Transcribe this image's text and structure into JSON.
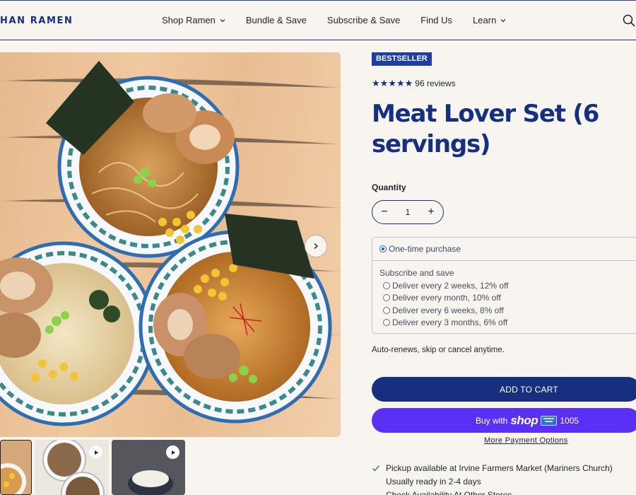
{
  "header": {
    "logo_text": "HAN RAMEN",
    "nav": [
      {
        "label": "Shop Ramen",
        "has_dropdown": true
      },
      {
        "label": "Bundle & Save",
        "has_dropdown": false
      },
      {
        "label": "Subscribe & Save",
        "has_dropdown": false
      },
      {
        "label": "Find Us",
        "has_dropdown": false
      },
      {
        "label": "Learn",
        "has_dropdown": true
      }
    ],
    "search_icon": "search-icon"
  },
  "gallery": {
    "next_icon": "chevron-right-icon",
    "thumbnails": [
      {
        "type": "image",
        "selected": true
      },
      {
        "type": "video",
        "icon": "play-icon"
      },
      {
        "type": "video",
        "icon": "play-icon"
      }
    ]
  },
  "product": {
    "badge": "BESTSELLER",
    "stars": "★★★★★",
    "rating_value": 5,
    "reviews": "96 reviews",
    "title": "Meat Lover Set (6 servings)",
    "quantity_label": "Quantity",
    "quantity": "1",
    "minus": "−",
    "plus": "+",
    "purchase": {
      "one_time": "One-time purchase",
      "subscribe_title": "Subscribe and save",
      "options": [
        "Deliver every 2 weeks, 12% off",
        "Deliver every month, 10% off",
        "Deliver every 6 weeks, 8% off",
        "Deliver every 3 months, 6% off"
      ]
    },
    "renew_note": "Auto-renews, skip or cancel anytime.",
    "add_to_cart": "ADD TO CART",
    "shop_pay": {
      "prefix": "Buy with",
      "brand": "shop",
      "card_last4": "1005"
    },
    "more_payment": "More Payment Options",
    "pickup_line1": "Pickup available at Irvine Farmers Market (Mariners Church)",
    "pickup_line2": "Usually ready in 2-4 days",
    "check_availability": "Check Availability At Other Stores"
  },
  "colors": {
    "brand_navy": "#16307f",
    "badge_blue": "#1c3ea6",
    "shop_purple": "#5a31f4",
    "background": "#f8f4ef"
  }
}
